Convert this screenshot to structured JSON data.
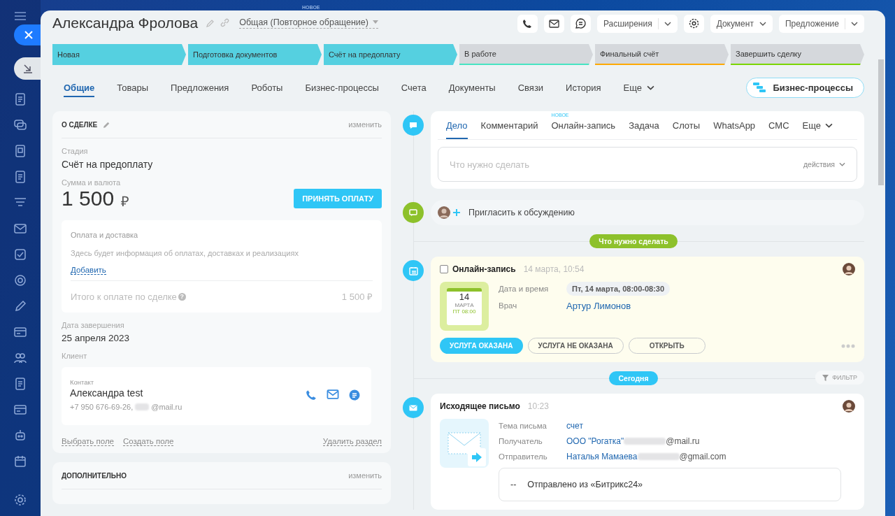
{
  "background_badge": "НОВОЕ",
  "title": "Александра Фролова",
  "category": "Общая (Повторное обращение)",
  "toolbar": [
    {
      "kind": "phone"
    },
    {
      "kind": "mail"
    },
    {
      "kind": "chat"
    },
    {
      "kind": "split",
      "label": "Расширения"
    },
    {
      "kind": "settings"
    },
    {
      "kind": "dropdown",
      "label": "Документ"
    },
    {
      "kind": "split",
      "label": "Предложение"
    }
  ],
  "stages": [
    {
      "label": "Новая",
      "reached": true,
      "color": "#55d0e0"
    },
    {
      "label": "Подготовка документов",
      "reached": true,
      "color": "#55d0e0"
    },
    {
      "label": "Счёт на предоплату",
      "reached": true,
      "color": "#55d0e0"
    },
    {
      "label": "В работе",
      "reached": false,
      "color": "#47e4c2"
    },
    {
      "label": "Финальный счёт",
      "reached": false,
      "color": "#ffa900"
    },
    {
      "label": "Завершить сделку",
      "reached": false,
      "color": "#7bd500"
    }
  ],
  "tabs": [
    {
      "label": "Общие",
      "selected": true
    },
    {
      "label": "Товары",
      "selected": false
    },
    {
      "label": "Предложения",
      "selected": false
    },
    {
      "label": "Роботы",
      "selected": false
    },
    {
      "label": "Бизнес-процессы",
      "selected": false
    },
    {
      "label": "Счета",
      "selected": false
    },
    {
      "label": "Документы",
      "selected": false
    },
    {
      "label": "Связи",
      "selected": false
    },
    {
      "label": "История",
      "selected": false
    },
    {
      "label": "Еще",
      "selected": false,
      "kind": "more"
    }
  ],
  "bp_button": "Бизнес-процессы",
  "deal": {
    "title": "О СДЕЛКЕ",
    "edit": "изменить",
    "stage_label": "Стадия",
    "stage": "Счёт на предоплату",
    "sum_label": "Сумма и валюта",
    "sum": "1 500",
    "currency": "₽",
    "pay_button": "ПРИНЯТЬ ОПЛАТУ",
    "payment": {
      "title": "Оплата и доставка",
      "text": "Здесь будет информация об оплатах, доставках и реализациях",
      "add": "Добавить",
      "total_label": "Итого к оплате по сделке",
      "help": "?",
      "total": "1 500 ₽"
    },
    "date_label": "Дата завершения",
    "date": "25 апреля 2023",
    "client_label": "Клиент",
    "contact": {
      "label": "Контакт",
      "name": "Александра test",
      "phone": "+7 950 676-69-26,",
      "email": "@mail.ru"
    },
    "links": [
      "Выбрать поле",
      "Создать поле"
    ],
    "delete": "Удалить раздел"
  },
  "extra": {
    "title": "ДОПОЛНИТЕЛЬНО",
    "edit": "изменить"
  },
  "composer": {
    "tabs": [
      {
        "label": "Дело",
        "selected": true
      },
      {
        "label": "Комментарий",
        "selected": false
      },
      {
        "label": "Онлайн-запись",
        "selected": false,
        "badge": "НОВОЕ"
      },
      {
        "label": "Задача",
        "selected": false
      },
      {
        "label": "Слоты",
        "selected": false
      },
      {
        "label": "WhatsApp",
        "selected": false
      },
      {
        "label": "СМС",
        "selected": false
      },
      {
        "label": "Еще",
        "selected": false,
        "kind": "more"
      }
    ],
    "placeholder": "Что нужно сделать",
    "actions": "действия"
  },
  "invite": "Пригласить к обсуждению",
  "todo_divider": "Что нужно сделать",
  "booking": {
    "checked": false,
    "title": "Онлайн-запись",
    "time": "14 марта, 10:54",
    "day": "14",
    "month": "МАРТА",
    "weekday_time": "ПТ 08:00",
    "fields": [
      {
        "label": "Дата и время",
        "value": "Пт, 14 марта, 08:00-08:30",
        "kind": "chip"
      },
      {
        "label": "Врач",
        "value": "Артур Лимонов",
        "kind": "link"
      }
    ],
    "buttons": [
      {
        "label": "УСЛУГА ОКАЗАНА",
        "kind": "primary"
      },
      {
        "label": "УСЛУГА НЕ ОКАЗАНА",
        "kind": "outline"
      },
      {
        "label": "ОТКРЫТЬ",
        "kind": "outline"
      }
    ]
  },
  "today_divider": "Сегодня",
  "filter": "ФИЛЬТР",
  "email": {
    "title": "Исходящее письмо",
    "time": "10:23",
    "fields": [
      {
        "label": "Тема письма",
        "name": "счет"
      },
      {
        "label": "Получатель",
        "name": "ООО \"Рогатка\"",
        "email": "@mail.ru"
      },
      {
        "label": "Отправитель",
        "name": "Наталья Мамаева",
        "email": "@gmail.com"
      }
    ],
    "dash": "--",
    "body": "Отправлено из «Битрикс24»"
  }
}
